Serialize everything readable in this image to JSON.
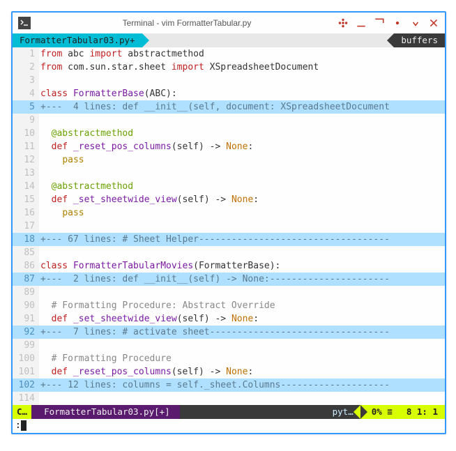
{
  "titlebar": {
    "title": "Terminal - vim FormatterTabular.py"
  },
  "tabbar": {
    "active_tab": "FormatterTabular03.py+",
    "buffers_label": "buffers"
  },
  "lines": [
    {
      "num": "1",
      "fold": false,
      "html": "<span class='def'>from</span> abc <span class='def'>import</span> abstractmethod"
    },
    {
      "num": "2",
      "fold": false,
      "html": "<span class='def'>from</span> com.sun.star.sheet <span class='def'>import</span> XSpreadsheetDocument"
    },
    {
      "num": "3",
      "fold": false,
      "html": ""
    },
    {
      "num": "4",
      "fold": false,
      "html": "<span class='def'>class</span> <span class='kw'>FormatterBase</span>(ABC):"
    },
    {
      "num": "5",
      "fold": true,
      "html": "+---  4 lines: def __init__(self, document: XSpreadsheetDocument"
    },
    {
      "num": "9",
      "fold": false,
      "html": ""
    },
    {
      "num": "10",
      "fold": false,
      "html": "  <span class='anno'>@abstractmethod</span>"
    },
    {
      "num": "11",
      "fold": false,
      "html": "  <span class='def'>def</span> <span class='kw'>_reset_pos_columns</span>(self) -&gt; <span class='type'>None</span>:"
    },
    {
      "num": "12",
      "fold": false,
      "html": "    <span class='pass'>pass</span>"
    },
    {
      "num": "13",
      "fold": false,
      "html": ""
    },
    {
      "num": "14",
      "fold": false,
      "html": "  <span class='anno'>@abstractmethod</span>"
    },
    {
      "num": "15",
      "fold": false,
      "html": "  <span class='def'>def</span> <span class='kw'>_set_sheetwide_view</span>(self) -&gt; <span class='type'>None</span>:"
    },
    {
      "num": "16",
      "fold": false,
      "html": "    <span class='pass'>pass</span>"
    },
    {
      "num": "17",
      "fold": false,
      "html": ""
    },
    {
      "num": "18",
      "fold": true,
      "html": "+--- 67 lines: # Sheet Helper-----------------------------------"
    },
    {
      "num": "85",
      "fold": false,
      "html": ""
    },
    {
      "num": "86",
      "fold": false,
      "html": "<span class='def'>class</span> <span class='kw'>FormatterTabularMovies</span>(FormatterBase):"
    },
    {
      "num": "87",
      "fold": true,
      "html": "+---  2 lines: def __init__(self) -> None:----------------------"
    },
    {
      "num": "89",
      "fold": false,
      "html": ""
    },
    {
      "num": "90",
      "fold": false,
      "html": "  <span class='comment'># Formatting Procedure: Abstract Override</span>"
    },
    {
      "num": "91",
      "fold": false,
      "html": "  <span class='def'>def</span> <span class='kw'>_set_sheetwide_view</span>(self) -&gt; <span class='type'>None</span>:"
    },
    {
      "num": "92",
      "fold": true,
      "html": "+---  7 lines: # activate sheet---------------------------------"
    },
    {
      "num": "99",
      "fold": false,
      "html": ""
    },
    {
      "num": "100",
      "fold": false,
      "html": "  <span class='comment'># Formatting Procedure</span>"
    },
    {
      "num": "101",
      "fold": false,
      "html": "  <span class='def'>def</span> <span class='kw'>_reset_pos_columns</span>(self) -&gt; <span class='type'>None</span>:"
    },
    {
      "num": "102",
      "fold": true,
      "html": "+--- 12 lines: columns = self._sheet.Columns--------------------"
    },
    {
      "num": "114",
      "fold": false,
      "html": ""
    }
  ],
  "statusbar": {
    "mode": "C…",
    "file": "FormatterTabular03.py[+]",
    "filetype": "pyt…",
    "percent": "0% ≡",
    "position": "8 1: 1"
  },
  "cmdline": {
    "prompt": ":"
  }
}
